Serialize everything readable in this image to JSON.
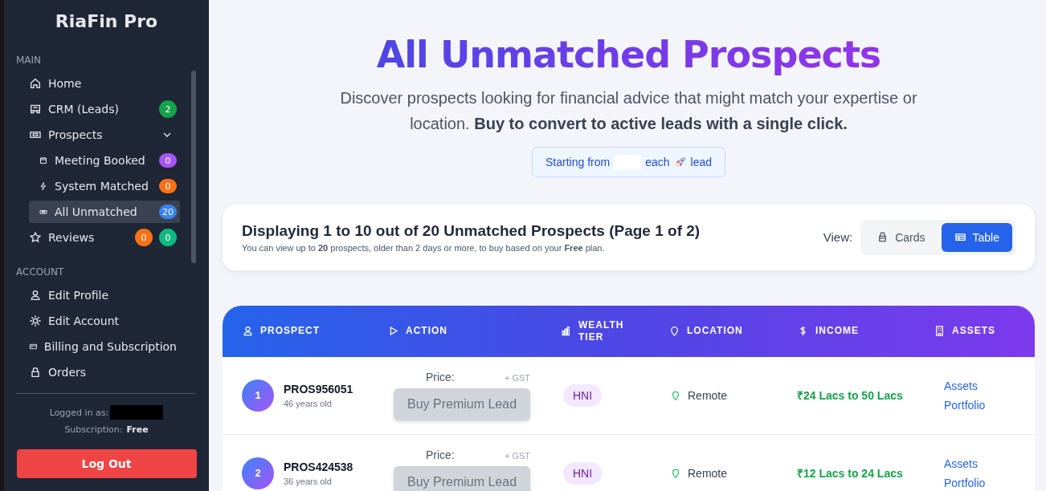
{
  "sidebar": {
    "brand": "RiaFin Pro",
    "sections": [
      {
        "heading": "MAIN",
        "items": [
          {
            "label": "Home",
            "selected": false
          },
          {
            "label": "CRM (Leads)",
            "selected": false,
            "badges": [
              {
                "text": "2",
                "color": "#16a34a"
              }
            ]
          },
          {
            "label": "Prospects",
            "selected": false,
            "expanded": true,
            "children": [
              {
                "label": "Meeting Booked",
                "selected": false,
                "badges": [
                  {
                    "text": "0",
                    "color": "#a855f7"
                  }
                ]
              },
              {
                "label": "System Matched",
                "selected": false,
                "badges": [
                  {
                    "text": "0",
                    "color": "#f97316"
                  }
                ]
              },
              {
                "label": "All Unmatched",
                "selected": true,
                "badges": [
                  {
                    "text": "20",
                    "color": "#3b82f6"
                  }
                ]
              }
            ]
          },
          {
            "label": "Reviews",
            "selected": false,
            "badges": [
              {
                "text": "0",
                "color": "#f97316"
              },
              {
                "text": "0",
                "color": "#10b981"
              }
            ]
          }
        ]
      },
      {
        "heading": "ACCOUNT",
        "items": [
          {
            "label": "Edit Profile",
            "selected": false
          },
          {
            "label": "Edit Account",
            "selected": false
          },
          {
            "label": "Billing and Subscription",
            "selected": false
          },
          {
            "label": "Orders",
            "selected": false
          }
        ]
      }
    ],
    "logged_in_label": "Logged in as:",
    "subscription_label": "Subscription:",
    "plan": "Free",
    "logout": "Log Out"
  },
  "hero": {
    "title": "All Unmatched Prospects",
    "subtitle": "Discover prospects looking for financial advice that might match your expertise or location. **Buy to convert to active leads with a single click.**",
    "price_note": {
      "before": "Starting from",
      "after": "each",
      "end": "lead"
    }
  },
  "summary": {
    "heading": "Displaying 1 to 10 out of 20 Unmatched Prospects (Page 1 of 2)",
    "note": "You can view up to **20** prospects, older than 2 days or more, to buy based on your **Free** plan.",
    "view_label": "View:",
    "view_options": [
      {
        "label": "Cards",
        "selected": false
      },
      {
        "label": "Table",
        "selected": true
      }
    ]
  },
  "table": {
    "columns": [
      "PROSPECT",
      "ACTION",
      "WEALTH TIER",
      "LOCATION",
      "INCOME",
      "ASSETS"
    ],
    "rows": [
      {
        "number": "1",
        "id": "PROS956051",
        "age": "46 years old",
        "price_label": "Price:",
        "tax": "+ GST",
        "button": "Buy Premium Lead",
        "disabled": true,
        "tier": "HNI",
        "location": "Remote",
        "income": "₹24 Lacs to 50 Lacs",
        "links": [
          "Assets",
          "Portfolio"
        ]
      },
      {
        "number": "2",
        "id": "PROS424538",
        "age": "36 years old",
        "price_label": "Price:",
        "tax": "+ GST",
        "button": "Buy Premium Lead",
        "disabled": true,
        "tier": "HNI",
        "location": "Remote",
        "income": "₹12 Lacs to 24 Lacs",
        "links": [
          "Assets",
          "Portfolio"
        ]
      }
    ]
  }
}
